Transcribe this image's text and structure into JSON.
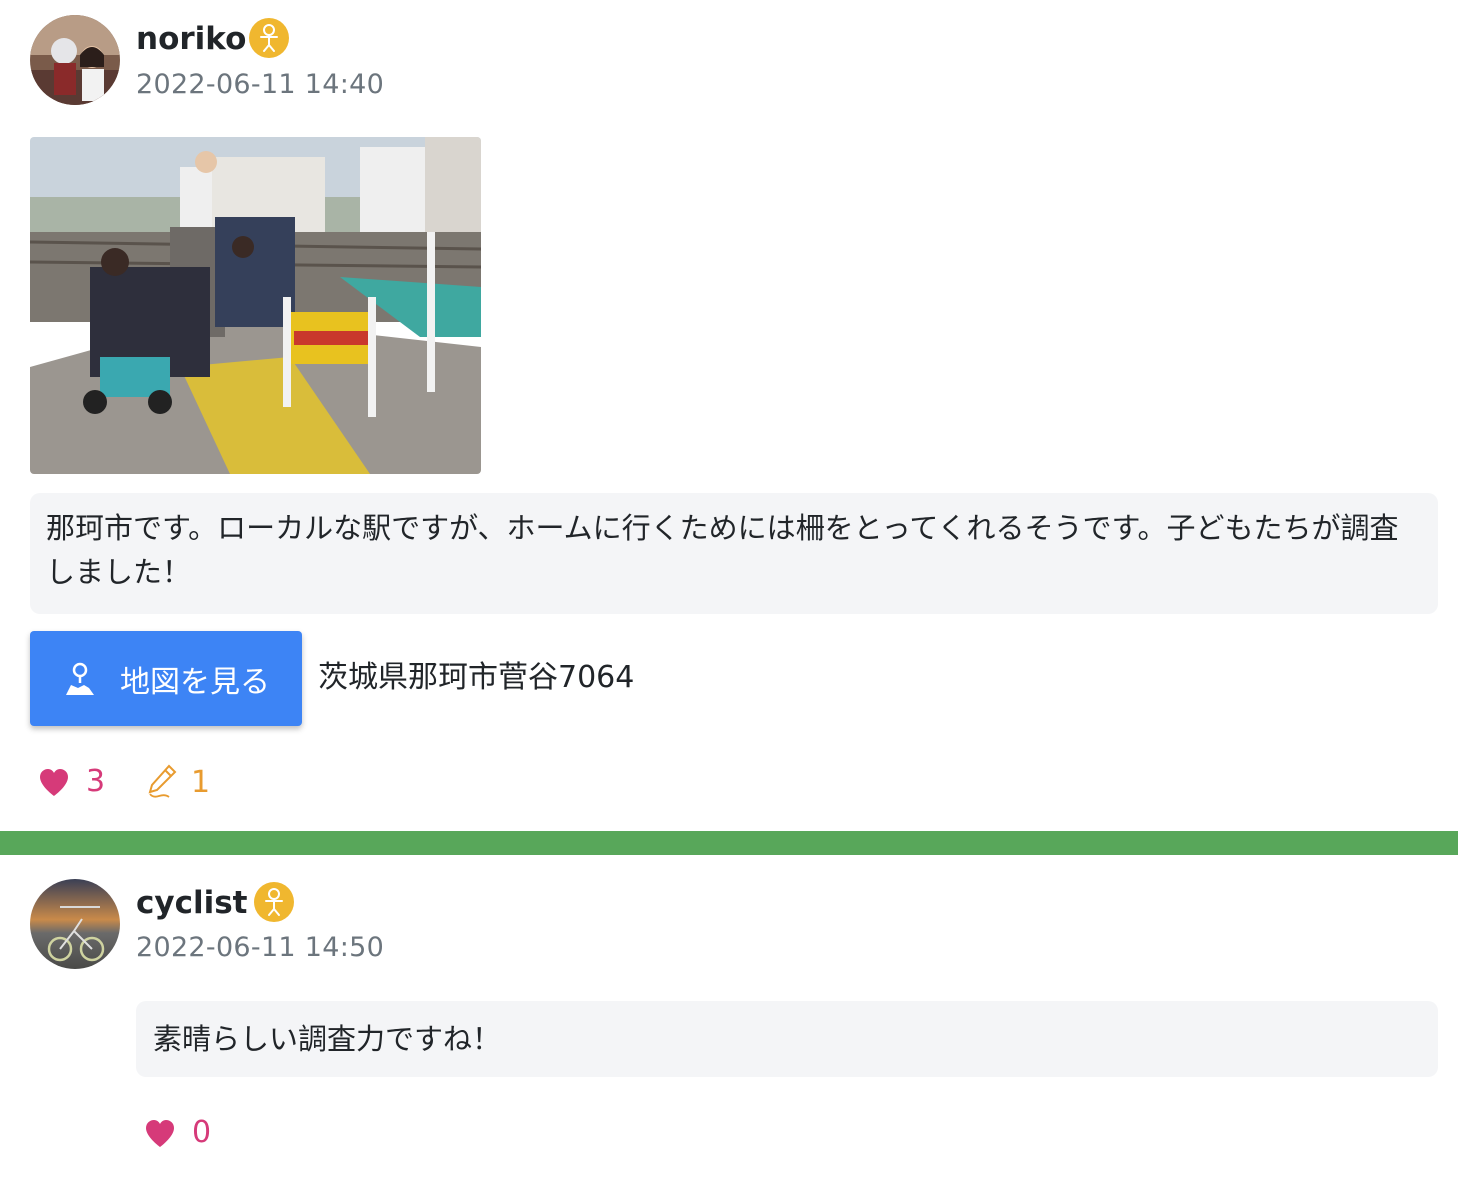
{
  "post": {
    "username": "noriko",
    "timestamp": "2022-06-11 14:40",
    "body": "那珂市です。ローカルな駅ですが、ホームに行くためには柵をとってくれるそうです。子どもたちが調査しました！",
    "map_button_label": "地図を見る",
    "address": "茨城県那珂市菅谷7064",
    "like_count": "3",
    "comment_count": "1"
  },
  "comment": {
    "username": "cyclist",
    "timestamp": "2022-06-11 14:50",
    "body": "素晴らしい調査力ですね！",
    "like_count": "0"
  },
  "colors": {
    "like": "#d63a79",
    "comment": "#e89b2f",
    "map_button": "#3d84f5",
    "divider": "#58a75a",
    "badge": "#f0b72f"
  },
  "icons": {
    "badge": "person-badge-icon",
    "map": "map-pin-icon",
    "like": "heart-icon",
    "comment": "pencil-icon"
  }
}
